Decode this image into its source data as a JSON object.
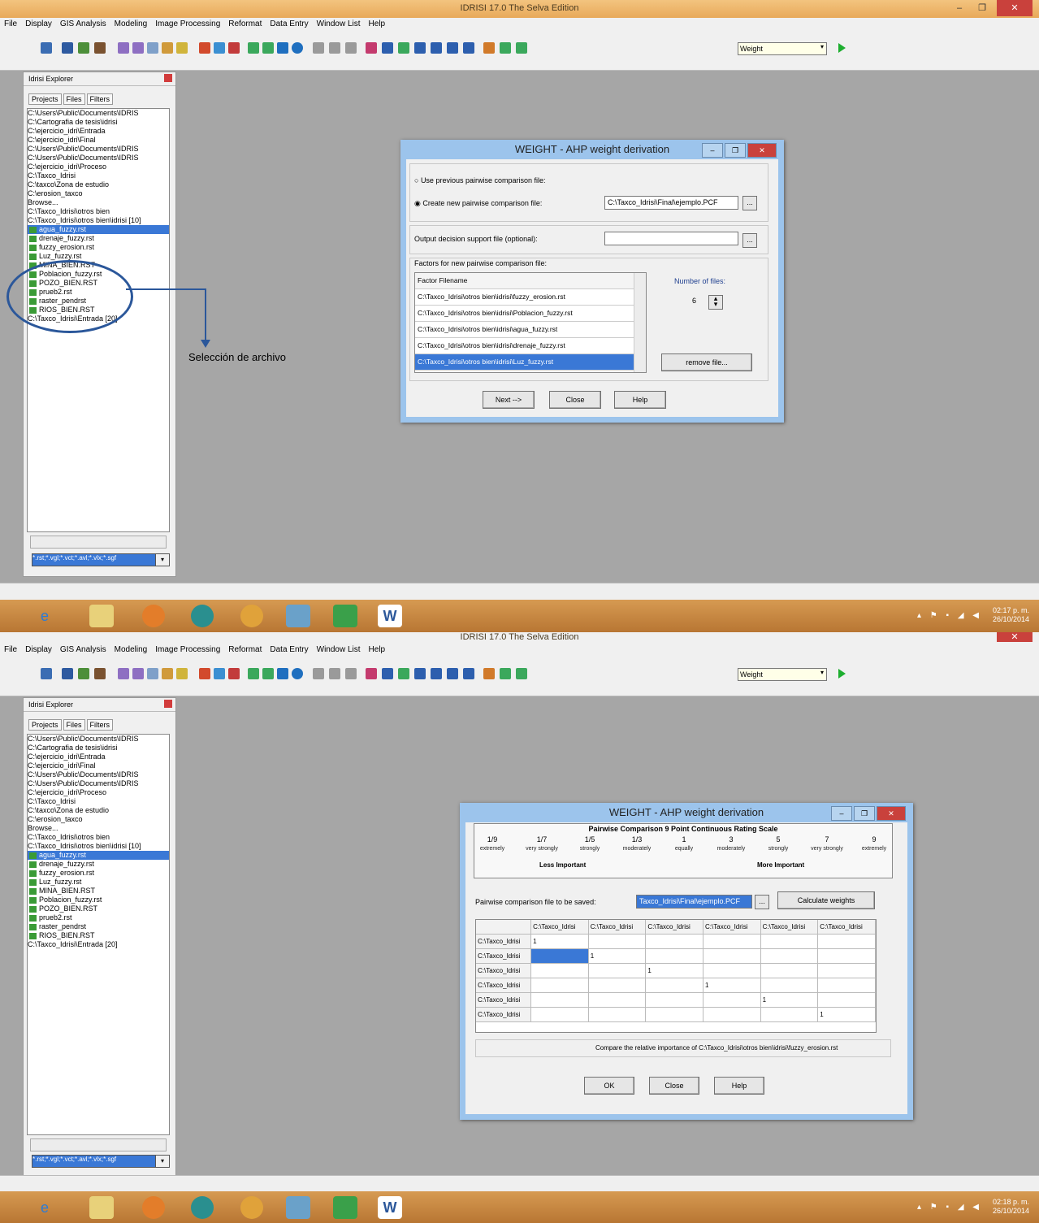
{
  "screen1": {
    "window_title": "IDRISI 17.0    The Selva Edition",
    "menu": [
      "File",
      "Display",
      "GIS Analysis",
      "Modeling",
      "Image Processing",
      "Reformat",
      "Data Entry",
      "Window List",
      "Help"
    ],
    "toolbar_combo": "Weight",
    "explorer": {
      "title": "Idrisi Explorer",
      "tabs": [
        "Projects",
        "Files",
        "Filters"
      ],
      "items": [
        "C:\\Users\\Public\\Documents\\IDRIS",
        "C:\\Cartografia de tesis\\idrisi",
        "C:\\ejercicio_idri\\Entrada",
        "C:\\ejercicio_idri\\Final",
        "C:\\Users\\Public\\Documents\\IDRIS",
        "C:\\Users\\Public\\Documents\\IDRIS",
        "C:\\ejercicio_idri\\Proceso",
        "C:\\Taxco_Idrisi",
        "C:\\taxco\\Zona de estudio",
        "C:\\erosion_taxco",
        "Browse...",
        "C:\\Taxco_Idrisi\\otros bien",
        "C:\\Taxco_Idrisi\\otros bien\\idrisi [10]"
      ],
      "files": [
        "agua_fuzzy.rst",
        "drenaje_fuzzy.rst",
        "fuzzy_erosion.rst",
        "Luz_fuzzy.rst",
        "MINA_BIEN.RST",
        "Poblacion_fuzzy.rst",
        "POZO_BIEN.RST",
        "prueb2.rst",
        "raster_pendrst",
        "RIOS_BIEN.RST"
      ],
      "last_item": "C:\\Taxco_Idrisi\\Entrada [20]",
      "filter_value": "*.rst;*.vgl;*.vct;*.avl;*.vlx;*.sgf"
    },
    "annotation": "Selección de  archivo",
    "dialog": {
      "title": "WEIGHT - AHP weight derivation",
      "radio_use_previous": "Use previous pairwise comparison file:",
      "radio_create_new": "Create new pairwise comparison file:",
      "pcf_value": "C:\\Taxco_Idrisi\\Final\\ejemplo.PCF",
      "output_label": "Output decision support file (optional):",
      "output_value": "",
      "factors_label": "Factors for new pairwise comparison file:",
      "factor_header": "Factor Filename",
      "factors": [
        "C:\\Taxco_Idrisi\\otros bien\\idrisi\\fuzzy_erosion.rst",
        "C:\\Taxco_Idrisi\\otros bien\\idrisi\\Poblacion_fuzzy.rst",
        "C:\\Taxco_Idrisi\\otros bien\\idrisi\\agua_fuzzy.rst",
        "C:\\Taxco_Idrisi\\otros bien\\idrisi\\drenaje_fuzzy.rst",
        "C:\\Taxco_Idrisi\\otros bien\\idrisi\\Luz_fuzzy.rst"
      ],
      "number_of_files_label": "Number of files:",
      "number_of_files": "6",
      "remove_file": "remove file...",
      "next": "Next -->",
      "close": "Close",
      "help": "Help"
    },
    "clock": {
      "time": "02:17 p. m.",
      "date": "26/10/2014"
    }
  },
  "screen2": {
    "window_title": "IDRISI 17.0    The Selva Edition",
    "menu": [
      "File",
      "Display",
      "GIS Analysis",
      "Modeling",
      "Image Processing",
      "Reformat",
      "Data Entry",
      "Window List",
      "Help"
    ],
    "toolbar_combo": "Weight",
    "explorer": {
      "title": "Idrisi Explorer",
      "tabs": [
        "Projects",
        "Files",
        "Filters"
      ],
      "items": [
        "C:\\Users\\Public\\Documents\\IDRIS",
        "C:\\Cartografia de tesis\\idrisi",
        "C:\\ejercicio_idri\\Entrada",
        "C:\\ejercicio_idri\\Final",
        "C:\\Users\\Public\\Documents\\IDRIS",
        "C:\\Users\\Public\\Documents\\IDRIS",
        "C:\\ejercicio_idri\\Proceso",
        "C:\\Taxco_Idrisi",
        "C:\\taxco\\Zona de estudio",
        "C:\\erosion_taxco",
        "Browse...",
        "C:\\Taxco_Idrisi\\otros bien",
        "C:\\Taxco_Idrisi\\otros bien\\idrisi [10]"
      ],
      "files": [
        "agua_fuzzy.rst",
        "drenaje_fuzzy.rst",
        "fuzzy_erosion.rst",
        "Luz_fuzzy.rst",
        "MINA_BIEN.RST",
        "Poblacion_fuzzy.rst",
        "POZO_BIEN.RST",
        "prueb2.rst",
        "raster_pendrst",
        "RIOS_BIEN.RST"
      ],
      "last_item": "C:\\Taxco_Idrisi\\Entrada [20]",
      "filter_value": "*.rst;*.vgl;*.vct;*.avl;*.vlx;*.sgf"
    },
    "dialog": {
      "title": "WEIGHT - AHP weight derivation",
      "scale_title": "Pairwise Comparison 9 Point Continuous Rating Scale",
      "scale_values": [
        "1/9",
        "1/7",
        "1/5",
        "1/3",
        "1",
        "3",
        "5",
        "7",
        "9"
      ],
      "scale_desc": [
        "extremely",
        "very strongly",
        "strongly",
        "moderately",
        "equally",
        "moderately",
        "strongly",
        "very strongly",
        "extremely"
      ],
      "less_important": "Less Important",
      "more_important": "More Important",
      "save_label": "Pairwise comparison file to be saved:",
      "save_value": "Taxco_Idrisi\\Final\\ejemplo.PCF",
      "calculate": "Calculate weights",
      "col_header": "C:\\Taxco_Idrisi",
      "row_header": "C:\\Taxco_Idrisi",
      "diag": "1",
      "compare_text": "Compare the relative importance of C:\\Taxco_Idrisi\\otros bien\\idrisi\\fuzzy_erosion.rst",
      "ok": "OK",
      "close": "Close",
      "help": "Help"
    },
    "clock": {
      "time": "02:18 p. m.",
      "date": "26/10/2014"
    }
  }
}
